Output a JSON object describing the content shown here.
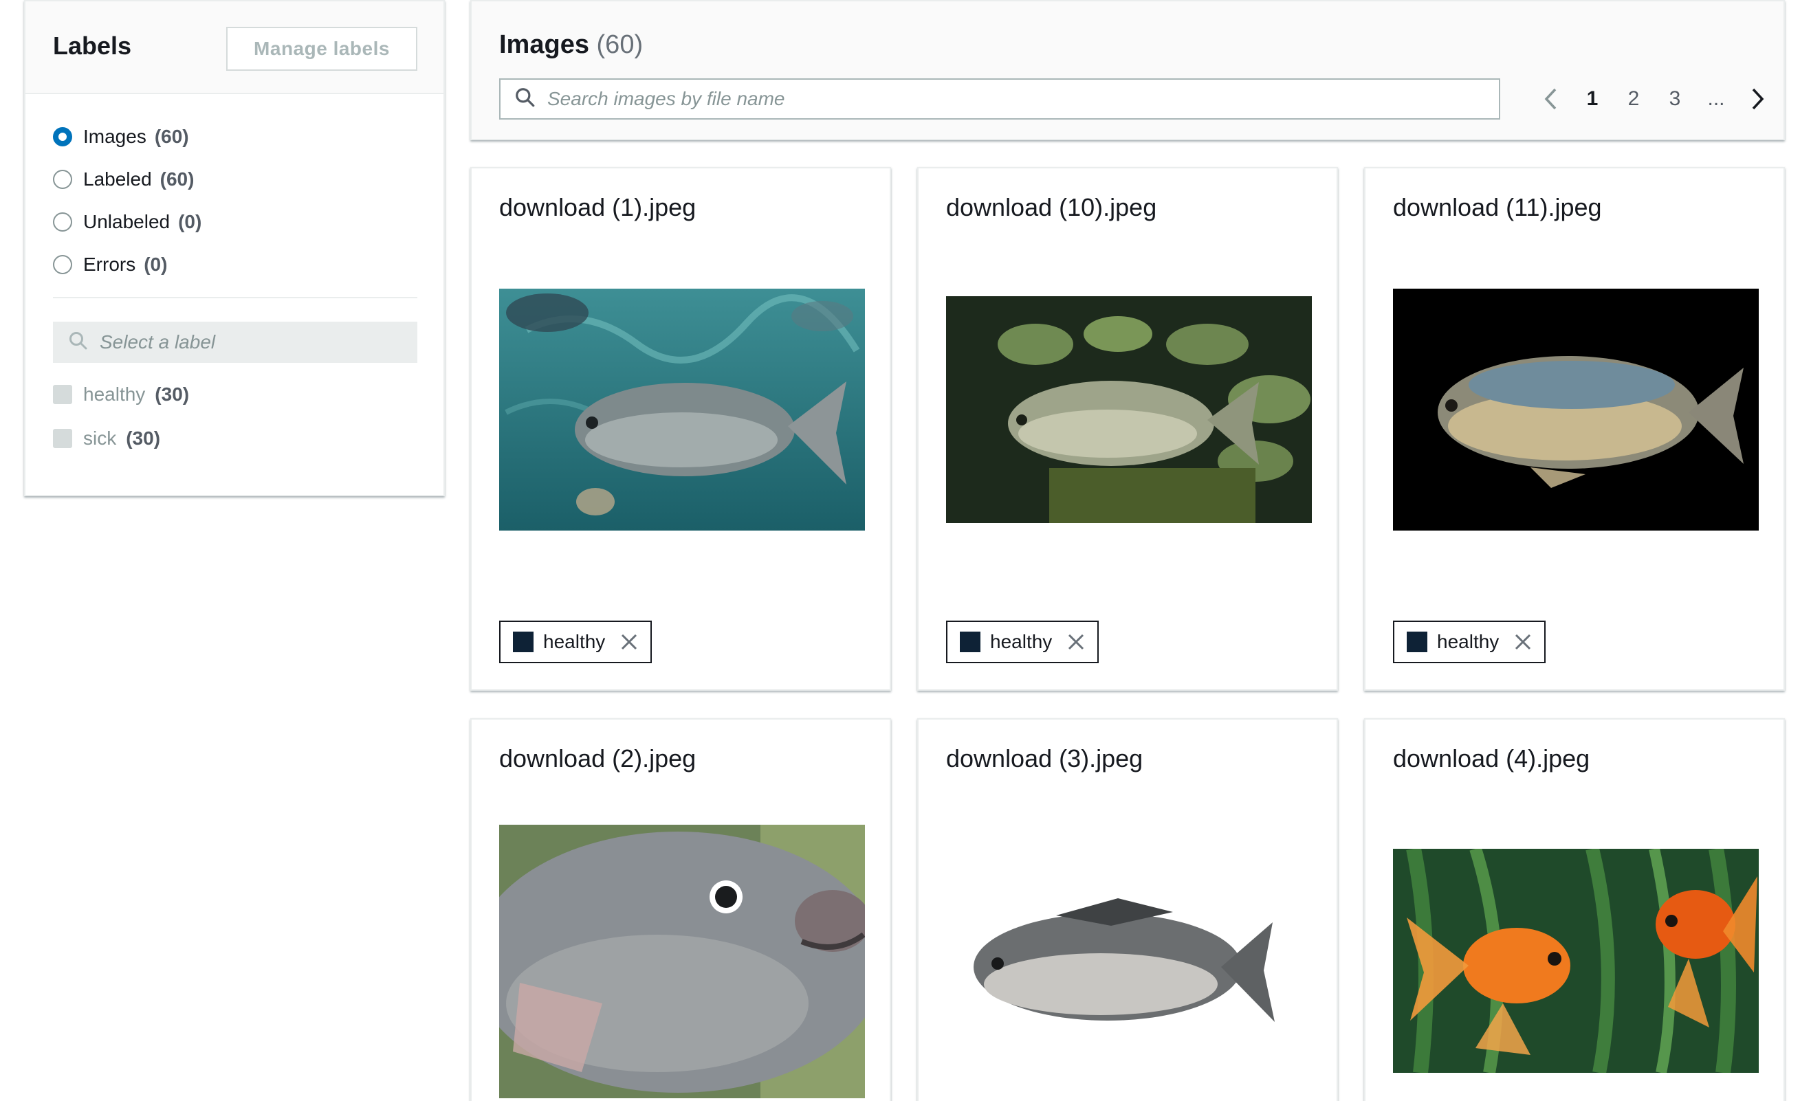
{
  "labels_panel": {
    "title": "Labels",
    "manage_button": "Manage labels",
    "filters": [
      {
        "label": "Images",
        "count": "(60)",
        "selected": true
      },
      {
        "label": "Labeled",
        "count": "(60)",
        "selected": false
      },
      {
        "label": "Unlabeled",
        "count": "(0)",
        "selected": false
      },
      {
        "label": "Errors",
        "count": "(0)",
        "selected": false
      }
    ],
    "label_search_placeholder": "Select a label",
    "labels": [
      {
        "name": "healthy",
        "count": "(30)"
      },
      {
        "name": "sick",
        "count": "(30)"
      }
    ]
  },
  "images_panel": {
    "title": "Images",
    "count": "(60)",
    "search_placeholder": "Search images by file name",
    "pagination": {
      "pages": [
        "1",
        "2",
        "3",
        "..."
      ],
      "current": "1"
    }
  },
  "cards": [
    {
      "filename": "download (1).jpeg",
      "tag": "healthy",
      "image": "tilapia-underwater-blue"
    },
    {
      "filename": "download (10).jpeg",
      "tag": "healthy",
      "image": "tilapia-school-green"
    },
    {
      "filename": "download (11).jpeg",
      "tag": "healthy",
      "image": "tilapia-black-background"
    },
    {
      "filename": "download (2).jpeg",
      "tag": null,
      "image": "tilapia-closeup-head"
    },
    {
      "filename": "download (3).jpeg",
      "tag": null,
      "image": "tilapia-white-background"
    },
    {
      "filename": "download (4).jpeg",
      "tag": null,
      "image": "goldfish-pair-plants"
    }
  ],
  "colors": {
    "accent": "#0073bb",
    "tag_swatch": "#0e2236",
    "border": "#eaeded"
  }
}
